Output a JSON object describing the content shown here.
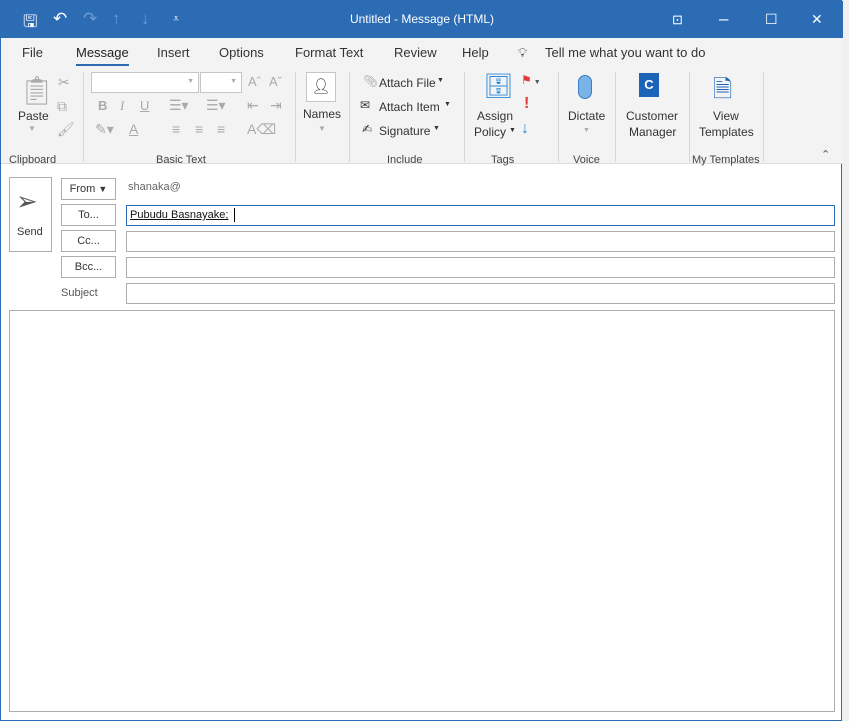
{
  "window": {
    "title": "Untitled  -  Message (HTML)"
  },
  "quick_access": {
    "icons": [
      "save-icon",
      "undo-icon",
      "redo-icon",
      "up-arrow-icon",
      "down-arrow-icon",
      "customize-icon"
    ]
  },
  "tabs": [
    "File",
    "Message",
    "Insert",
    "Options",
    "Format Text",
    "Review",
    "Help"
  ],
  "active_tab": "Message",
  "tell_me": "Tell me what you want to do",
  "ribbon": {
    "clipboard": {
      "paste": "Paste",
      "group": "Clipboard"
    },
    "basic_text": {
      "group": "Basic Text",
      "bold": "B",
      "italic": "I",
      "underline": "U",
      "font_color": "A"
    },
    "names": {
      "label": "Names"
    },
    "include": {
      "attach_file": "Attach File",
      "attach_item": "Attach Item",
      "signature": "Signature",
      "group": "Include"
    },
    "tags": {
      "assign": "Assign",
      "policy": "Policy",
      "group": "Tags",
      "high": "!"
    },
    "voice": {
      "dictate": "Dictate",
      "group": "Voice"
    },
    "customer": {
      "line1": "Customer",
      "line2": "Manager"
    },
    "templates": {
      "line1": "View",
      "line2": "Templates",
      "group": "My Templates"
    }
  },
  "compose": {
    "send": "Send",
    "from_label": "From",
    "from_value": "shanaka@",
    "to_label": "To...",
    "to_value": "Pubudu Basnayake;",
    "cc_label": "Cc...",
    "bcc_label": "Bcc...",
    "subject_label": "Subject",
    "cc_value": "",
    "bcc_value": "",
    "subject_value": "",
    "body": ""
  },
  "colors": {
    "accent": "#2b6cb5",
    "flag": "#e03a3a",
    "tag_arrow": "#2b8ad8"
  }
}
